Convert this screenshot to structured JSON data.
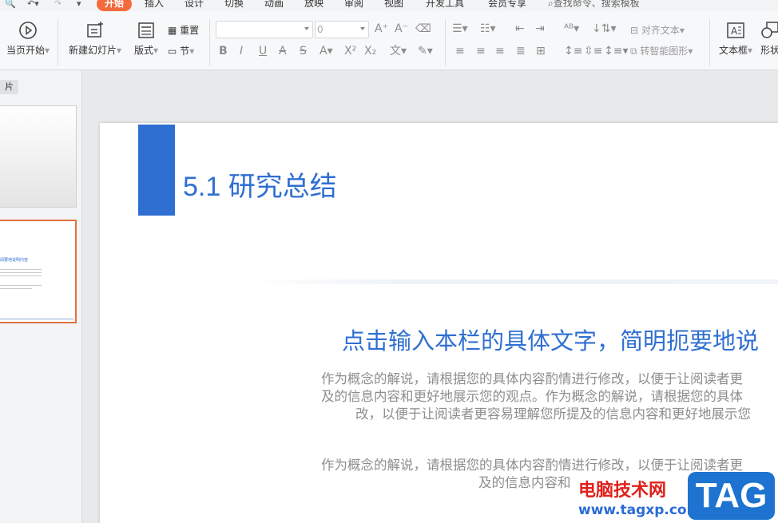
{
  "menu": {
    "tabs": [
      "开始",
      "插入",
      "设计",
      "切换",
      "动画",
      "放映",
      "审阅",
      "视图",
      "开发工具",
      "会员专享"
    ],
    "active_tab": "开始",
    "search_label": "查找命令、搜索模板"
  },
  "ribbon": {
    "from_current": "当页开始",
    "new_slide": "新建幻灯片",
    "layout": "版式",
    "reset": "重置",
    "section": "节",
    "font_size_value": "0",
    "align_text": "对齐文本",
    "smart_art": "转智能图形",
    "text_box": "文本框",
    "shape_partial": "形状"
  },
  "left_pane": {
    "tab_label": "片",
    "thumb2_title": "阅要地说明内容"
  },
  "slide": {
    "title": "5.1 研究总结",
    "subheading": "点击输入本栏的具体文字，简明扼要地说",
    "para1_lines": [
      "作为概念的解说，请根据您的具体内容酌情进行修改，以便于让阅读者更",
      "及的信息内容和更好地展示您的观点。作为概念的解说，请根据您的具体",
      "改，以便于让阅读者更容易理解您所提及的信息内容和更好地展示您"
    ],
    "para2_lines": [
      "作为概念的解说，请根据您的具体内容酌情进行修改，以便于让阅读者更",
      "及的信息内容和"
    ]
  },
  "watermark": {
    "site_name": "电脑技术网",
    "url": "www.tagxp.com",
    "tag": "TAG"
  },
  "colors": {
    "accent_orange": "#f46a3b",
    "slide_blue": "#2f6fd1",
    "watermark_red": "#e0201b",
    "tag_blue": "#1d73cf"
  }
}
